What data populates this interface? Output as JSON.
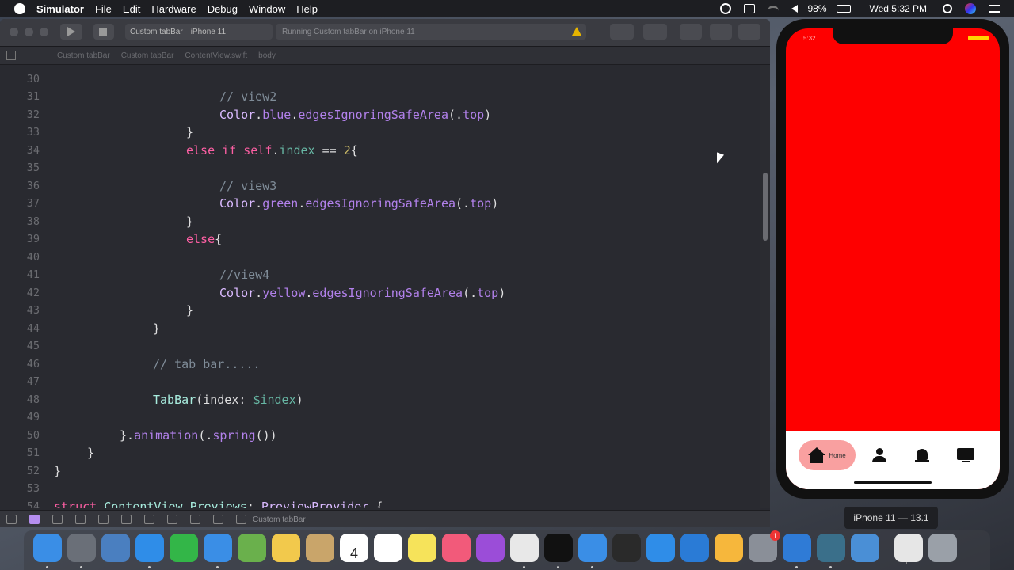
{
  "menubar": {
    "app_name": "Simulator",
    "menus": [
      "File",
      "Edit",
      "Hardware",
      "Debug",
      "Window",
      "Help"
    ],
    "battery": "98%",
    "clock": "Wed 5:32 PM"
  },
  "xcode": {
    "scheme_target": "Custom tabBar",
    "scheme_device": "iPhone 11",
    "activity": "Running Custom tabBar on iPhone 11",
    "warning_count": "1",
    "breadcrumb": [
      "Custom tabBar",
      "Custom tabBar",
      "ContentView.swift",
      "body"
    ],
    "debug_target": "Custom tabBar",
    "line_numbers": [
      "30",
      "31",
      "32",
      "33",
      "34",
      "35",
      "36",
      "37",
      "38",
      "39",
      "40",
      "41",
      "42",
      "43",
      "44",
      "45",
      "46",
      "47",
      "48",
      "49",
      "50",
      "51",
      "52",
      "53",
      "54"
    ],
    "code": {
      "l31": "// view2",
      "l32_a": "Color",
      "l32_b": "blue",
      "l32_c": "edgesIgnoringSafeArea",
      "l32_d": "top",
      "l34_kw1": "else",
      "l34_kw2": "if",
      "l34_self": "self",
      "l34_prop": "index",
      "l34_num": "2",
      "l36": "// view3",
      "l37_a": "Color",
      "l37_b": "green",
      "l37_c": "edgesIgnoringSafeArea",
      "l37_d": "top",
      "l39": "else",
      "l41": "//view4",
      "l42_a": "Color",
      "l42_b": "yellow",
      "l42_c": "edgesIgnoringSafeArea",
      "l42_d": "top",
      "l46": "// tab bar.....",
      "l48_a": "TabBar",
      "l48_b": "index",
      "l48_c": "$index",
      "l50_a": "animation",
      "l50_b": "spring",
      "l54_kw": "struct",
      "l54_name": "ContentView_Previews",
      "l54_proto": "PreviewProvider"
    }
  },
  "simulator": {
    "status_time": "5:32",
    "screen_color": "#fe0000",
    "active_tab_label": "Home",
    "tabs": [
      "home-icon",
      "person-icon",
      "bell-icon",
      "tv-icon"
    ],
    "device_label": "iPhone 11 — 13.1"
  },
  "dock": {
    "apps": [
      "finder-icon",
      "launchpad-icon",
      "preview-icon",
      "safari-icon",
      "facetime-icon",
      "messages-icon",
      "maps-icon",
      "photos-icon",
      "contacts-icon",
      "calendar-icon",
      "reminders-icon",
      "notes-icon",
      "music-icon",
      "podcasts-icon",
      "chrome-icon",
      "tv-icon",
      "xcode-icon",
      "final-cut-icon",
      "app-store-icon",
      "vscode-icon",
      "sketch-icon",
      "system-preferences-icon",
      "edge-icon",
      "creative-icon",
      "simulator-icon",
      "documents-icon",
      "trash-icon"
    ],
    "calendar_day": "4",
    "prefs_badge": "1"
  }
}
